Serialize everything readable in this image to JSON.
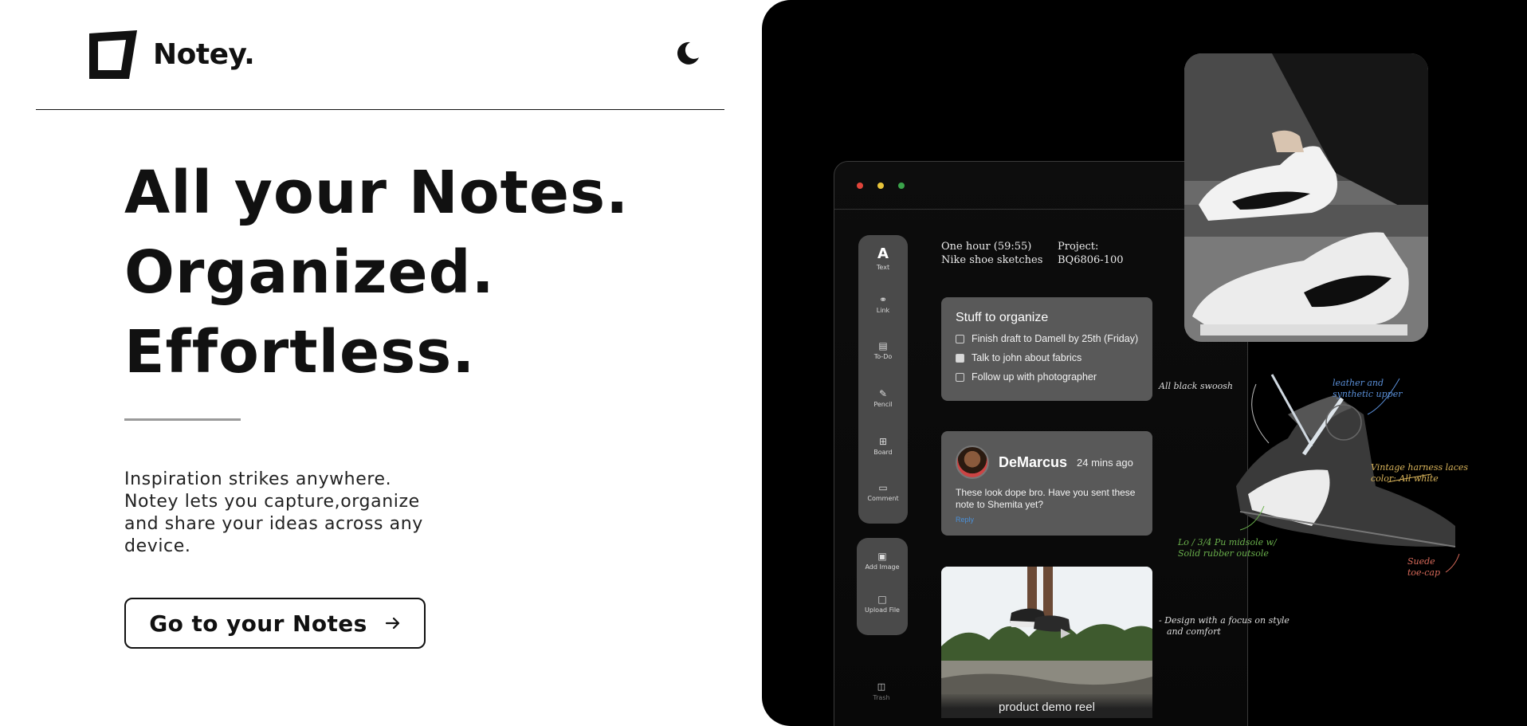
{
  "brand": {
    "name": "Notey."
  },
  "hero": {
    "lines": [
      "All your Notes.",
      "Organized.",
      "Effortless."
    ],
    "description": "Inspiration strikes anywhere. Notey lets you capture,organize and share your ideas across any device."
  },
  "cta": {
    "label": "Go to your Notes"
  },
  "preview": {
    "toolbar": {
      "items": [
        {
          "icon": "text-icon",
          "label": "Text"
        },
        {
          "icon": "link-icon",
          "label": "Link"
        },
        {
          "icon": "todo-icon",
          "label": "To-Do"
        },
        {
          "icon": "pencil-icon",
          "label": "Pencil"
        },
        {
          "icon": "board-icon",
          "label": "Board"
        },
        {
          "icon": "comment-icon",
          "label": "Comment"
        }
      ],
      "secondary": [
        {
          "icon": "image-icon",
          "label": "Add Image"
        },
        {
          "icon": "file-icon",
          "label": "Upload File"
        }
      ],
      "trash_label": "Trash"
    },
    "handwritten": {
      "left": [
        "One hour (59:55)",
        "Nike shoe sketches"
      ],
      "right": [
        "Project:",
        "BQ6806-100"
      ]
    },
    "todo": {
      "title": "Stuff to organize",
      "items": [
        {
          "text": "Finish draft to Damell by 25th (Friday)",
          "checked": false
        },
        {
          "text": "Talk to john about fabrics",
          "checked": true
        },
        {
          "text": "Follow up with photographer",
          "checked": false
        }
      ]
    },
    "comment": {
      "name": "DeMarcus",
      "time": "24 mins ago",
      "body": "These look dope bro. Have you sent these note to Shemita yet?",
      "reply": "Reply"
    },
    "video": {
      "caption": "product demo reel"
    },
    "sketch_notes": {
      "a": "All black swoosh",
      "b": [
        "leather and",
        "synthetic upper"
      ],
      "c": [
        "Vintage harness laces",
        "color: All white"
      ],
      "d": [
        "Lo / 3/4 Pu midsole w/",
        "Solid rubber outsole"
      ],
      "e": [
        "Suede",
        "toe-cap"
      ],
      "f": [
        "- Design with a focus on style",
        "and comfort"
      ]
    },
    "colors": {
      "dot_red": "#e0443a",
      "dot_yellow": "#e8c43a",
      "dot_green": "#3aa34a",
      "reply_blue": "#4a90d9"
    }
  }
}
